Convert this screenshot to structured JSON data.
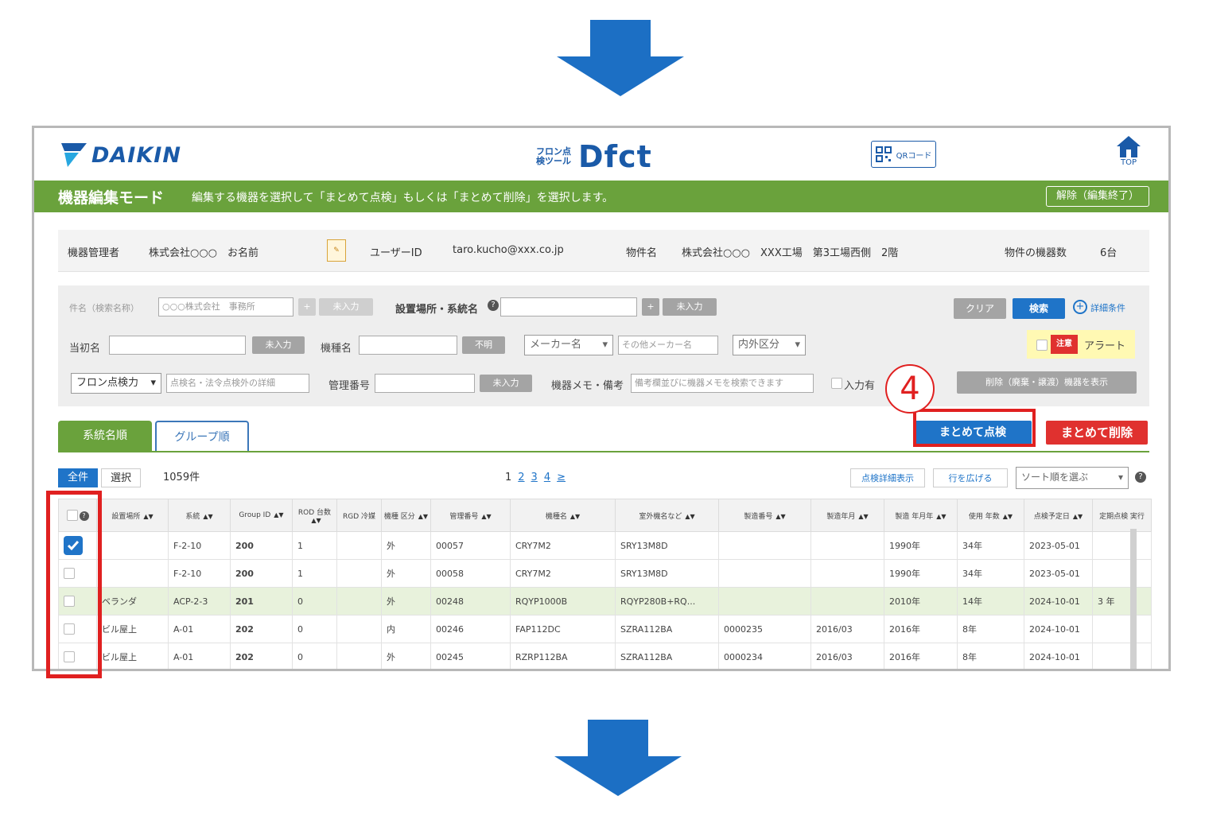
{
  "brand": {
    "logo_text": "DAIKIN",
    "app_sub": "フロン点検ツール",
    "app_name": "Dfct",
    "qr_label": "QRコード",
    "home_label": "TOP"
  },
  "mode_bar": {
    "title": "機器編集モード",
    "description": "編集する機器を選択して「まとめて点検」もしくは「まとめて削除」を選択します。",
    "release_label": "解除（編集終了）"
  },
  "info": {
    "manager_label": "機器管理者",
    "manager_value": "株式会社○○○　お名前",
    "user_id_label": "ユーザーID",
    "user_id_value": "taro.kucho@xxx.co.jp",
    "property_label": "物件名",
    "property_value": "株式会社○○○　XXX工場　第3工場西側　2階",
    "count_label": "物件の機器数",
    "count_value": "6台"
  },
  "search": {
    "case_label": "件名（検索名称）",
    "case_placeholder": "○○○株式会社　事務所",
    "unentered": "未入力",
    "location_label": "設置場所・系統名",
    "clear_label": "クリア",
    "search_label": "検索",
    "detail_label": "詳細条件",
    "building_label": "当初名",
    "model_label": "機種名",
    "unknown_label": "不明",
    "maker_placeholder": "メーカー名",
    "other_maker_placeholder": "その他メーカー名",
    "inout_placeholder": "内外区分",
    "alert_label": "アラート",
    "alert_badge": "注意",
    "freon_select": "フロン点検力",
    "freon_placeholder": "点検名・法令点検外の詳細",
    "mgmt_label": "管理番号",
    "memo_label": "機器メモ・備考",
    "memo_placeholder": "備考欄並びに機器メモを検索できます",
    "input_label": "入力有",
    "show_deleted_label": "削除（廃棄・譲渡）機器を表示"
  },
  "actions": {
    "bulk_inspect": "まとめて点検",
    "bulk_delete": "まとめて削除",
    "step_number": "4"
  },
  "tabs": {
    "facility": "系統名順",
    "group": "グループ順"
  },
  "list_toolbar": {
    "all_label": "全件",
    "select_label": "選択",
    "count": "1059件",
    "pager": [
      "1",
      "2",
      "3",
      "4",
      "≥"
    ],
    "detail_view": "点検詳細表示",
    "wrap_rows": "行を広げる",
    "sort_placeholder": "ソート順を選ぶ"
  },
  "table": {
    "headers": [
      "設置場所",
      "系統",
      "Group ID",
      "ROD 台数",
      "RGD 冷媒",
      "機種 区分",
      "管理番号",
      "機種名",
      "室外機名など",
      "製造番号",
      "製造年月",
      "製造 年月年",
      "使用 年数",
      "点検予定日",
      "定期点検 実行"
    ],
    "rows": [
      {
        "checked": true,
        "loc": "",
        "sys": "F-2-10",
        "group": "200",
        "rod": "1",
        "rgd": "",
        "kind": "外",
        "no": "00057",
        "model": "CRY7M2",
        "outdoor": "SRY13M8D",
        "serial": "",
        "mfg": "",
        "year": "1990年",
        "age": "34年",
        "date": "2023-05-01",
        "last": ""
      },
      {
        "checked": false,
        "loc": "",
        "sys": "F-2-10",
        "group": "200",
        "rod": "1",
        "rgd": "",
        "kind": "外",
        "no": "00058",
        "model": "CRY7M2",
        "outdoor": "SRY13M8D",
        "serial": "",
        "mfg": "",
        "year": "1990年",
        "age": "34年",
        "date": "2023-05-01",
        "last": ""
      },
      {
        "checked": false,
        "loc": "ベランダ",
        "sys": "ACP-2-3",
        "group": "201",
        "rod": "0",
        "rgd": "",
        "kind": "外",
        "no": "00248",
        "model": "RQYP1000B",
        "outdoor": "RQYP280B+RQ...",
        "serial": "",
        "mfg": "",
        "year": "2010年",
        "age": "14年",
        "date": "2024-10-01",
        "last": "3 年"
      },
      {
        "checked": false,
        "loc": "ビル屋上",
        "sys": "A-01",
        "group": "202",
        "rod": "0",
        "rgd": "",
        "kind": "内",
        "no": "00246",
        "model": "FAP112DC",
        "outdoor": "SZRA112BA",
        "serial": "0000235",
        "mfg": "2016/03",
        "year": "2016年",
        "age": "8年",
        "date": "2024-10-01",
        "last": ""
      },
      {
        "checked": false,
        "loc": "ビル屋上",
        "sys": "A-01",
        "group": "202",
        "rod": "0",
        "rgd": "",
        "kind": "外",
        "no": "00245",
        "model": "RZRP112BA",
        "outdoor": "SZRA112BA",
        "serial": "0000234",
        "mfg": "2016/03",
        "year": "2016年",
        "age": "8年",
        "date": "2024-10-01",
        "last": ""
      }
    ]
  },
  "colors": {
    "brand_blue": "#1a5aa8",
    "mode_green": "#6aa23c",
    "action_blue": "#1f74c8",
    "delete_red": "#e0312f",
    "annotation_red": "#e02020"
  }
}
